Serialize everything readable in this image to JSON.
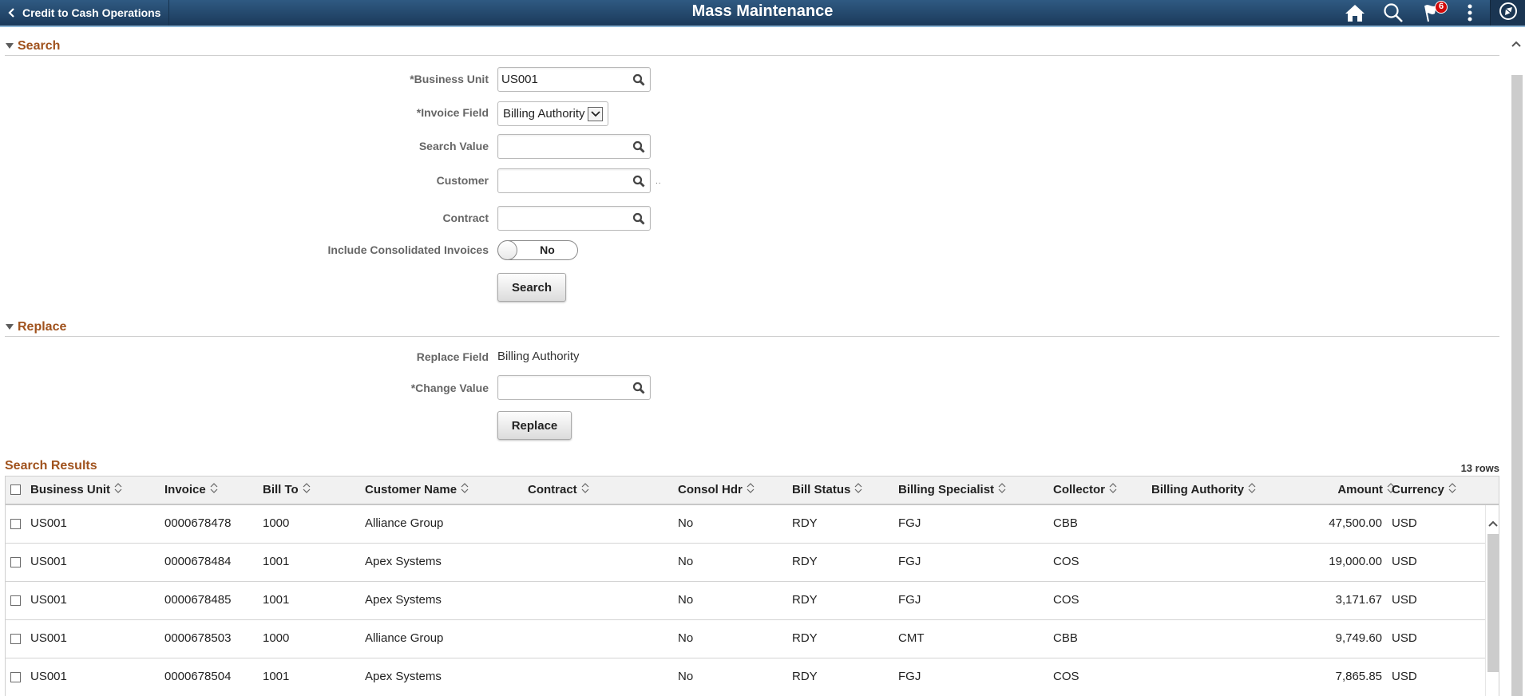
{
  "header": {
    "back_label": "Credit to Cash Operations",
    "title": "Mass Maintenance",
    "icons": [
      "home-icon",
      "search-icon",
      "notifications-flag-icon",
      "actions-menu-icon",
      "navbar-compass-icon"
    ],
    "notification_count": "6"
  },
  "search_section": {
    "title": "Search",
    "business_unit": {
      "label": "*Business Unit",
      "value": "US001",
      "placeholder": ""
    },
    "invoice_field": {
      "label": "*Invoice Field",
      "selected": "Billing Authority"
    },
    "search_value": {
      "label": "Search Value",
      "value": ""
    },
    "customer": {
      "label": "Customer",
      "value": "",
      "trailing": ".."
    },
    "contract": {
      "label": "Contract",
      "value": ""
    },
    "include_consolidated": {
      "label": "Include Consolidated Invoices",
      "state": "No"
    },
    "search_button": "Search"
  },
  "replace_section": {
    "title": "Replace",
    "replace_field": {
      "label": "Replace Field",
      "value": "Billing Authority"
    },
    "change_value": {
      "label": "*Change Value",
      "value": ""
    },
    "replace_button": "Replace"
  },
  "results": {
    "title": "Search Results",
    "row_count": "13 rows",
    "columns": [
      "Business Unit",
      "Invoice",
      "Bill To",
      "Customer Name",
      "Contract",
      "Consol Hdr",
      "Bill Status",
      "Billing Specialist",
      "Collector",
      "Billing Authority",
      "Amount",
      "Currency"
    ],
    "rows": [
      {
        "business_unit": "US001",
        "invoice": "0000678478",
        "bill_to": "1000",
        "customer_name": "Alliance Group",
        "contract": "",
        "consol_hdr": "No",
        "bill_status": "RDY",
        "billing_specialist": "FGJ",
        "collector": "CBB",
        "billing_authority": "",
        "amount": "47,500.00",
        "currency": "USD"
      },
      {
        "business_unit": "US001",
        "invoice": "0000678484",
        "bill_to": "1001",
        "customer_name": "Apex Systems",
        "contract": "",
        "consol_hdr": "No",
        "bill_status": "RDY",
        "billing_specialist": "FGJ",
        "collector": "COS",
        "billing_authority": "",
        "amount": "19,000.00",
        "currency": "USD"
      },
      {
        "business_unit": "US001",
        "invoice": "0000678485",
        "bill_to": "1001",
        "customer_name": "Apex Systems",
        "contract": "",
        "consol_hdr": "No",
        "bill_status": "RDY",
        "billing_specialist": "FGJ",
        "collector": "COS",
        "billing_authority": "",
        "amount": "3,171.67",
        "currency": "USD"
      },
      {
        "business_unit": "US001",
        "invoice": "0000678503",
        "bill_to": "1000",
        "customer_name": "Alliance Group",
        "contract": "",
        "consol_hdr": "No",
        "bill_status": "RDY",
        "billing_specialist": "CMT",
        "collector": "CBB",
        "billing_authority": "",
        "amount": "9,749.60",
        "currency": "USD"
      },
      {
        "business_unit": "US001",
        "invoice": "0000678504",
        "bill_to": "1001",
        "customer_name": "Apex Systems",
        "contract": "",
        "consol_hdr": "No",
        "bill_status": "RDY",
        "billing_specialist": "FGJ",
        "collector": "COS",
        "billing_authority": "",
        "amount": "7,865.85",
        "currency": "USD"
      }
    ]
  },
  "colors": {
    "header_top": "#2f5a82",
    "header_bottom": "#1b3a5a",
    "section_title": "#a0521d",
    "badge": "#d20a0a"
  }
}
